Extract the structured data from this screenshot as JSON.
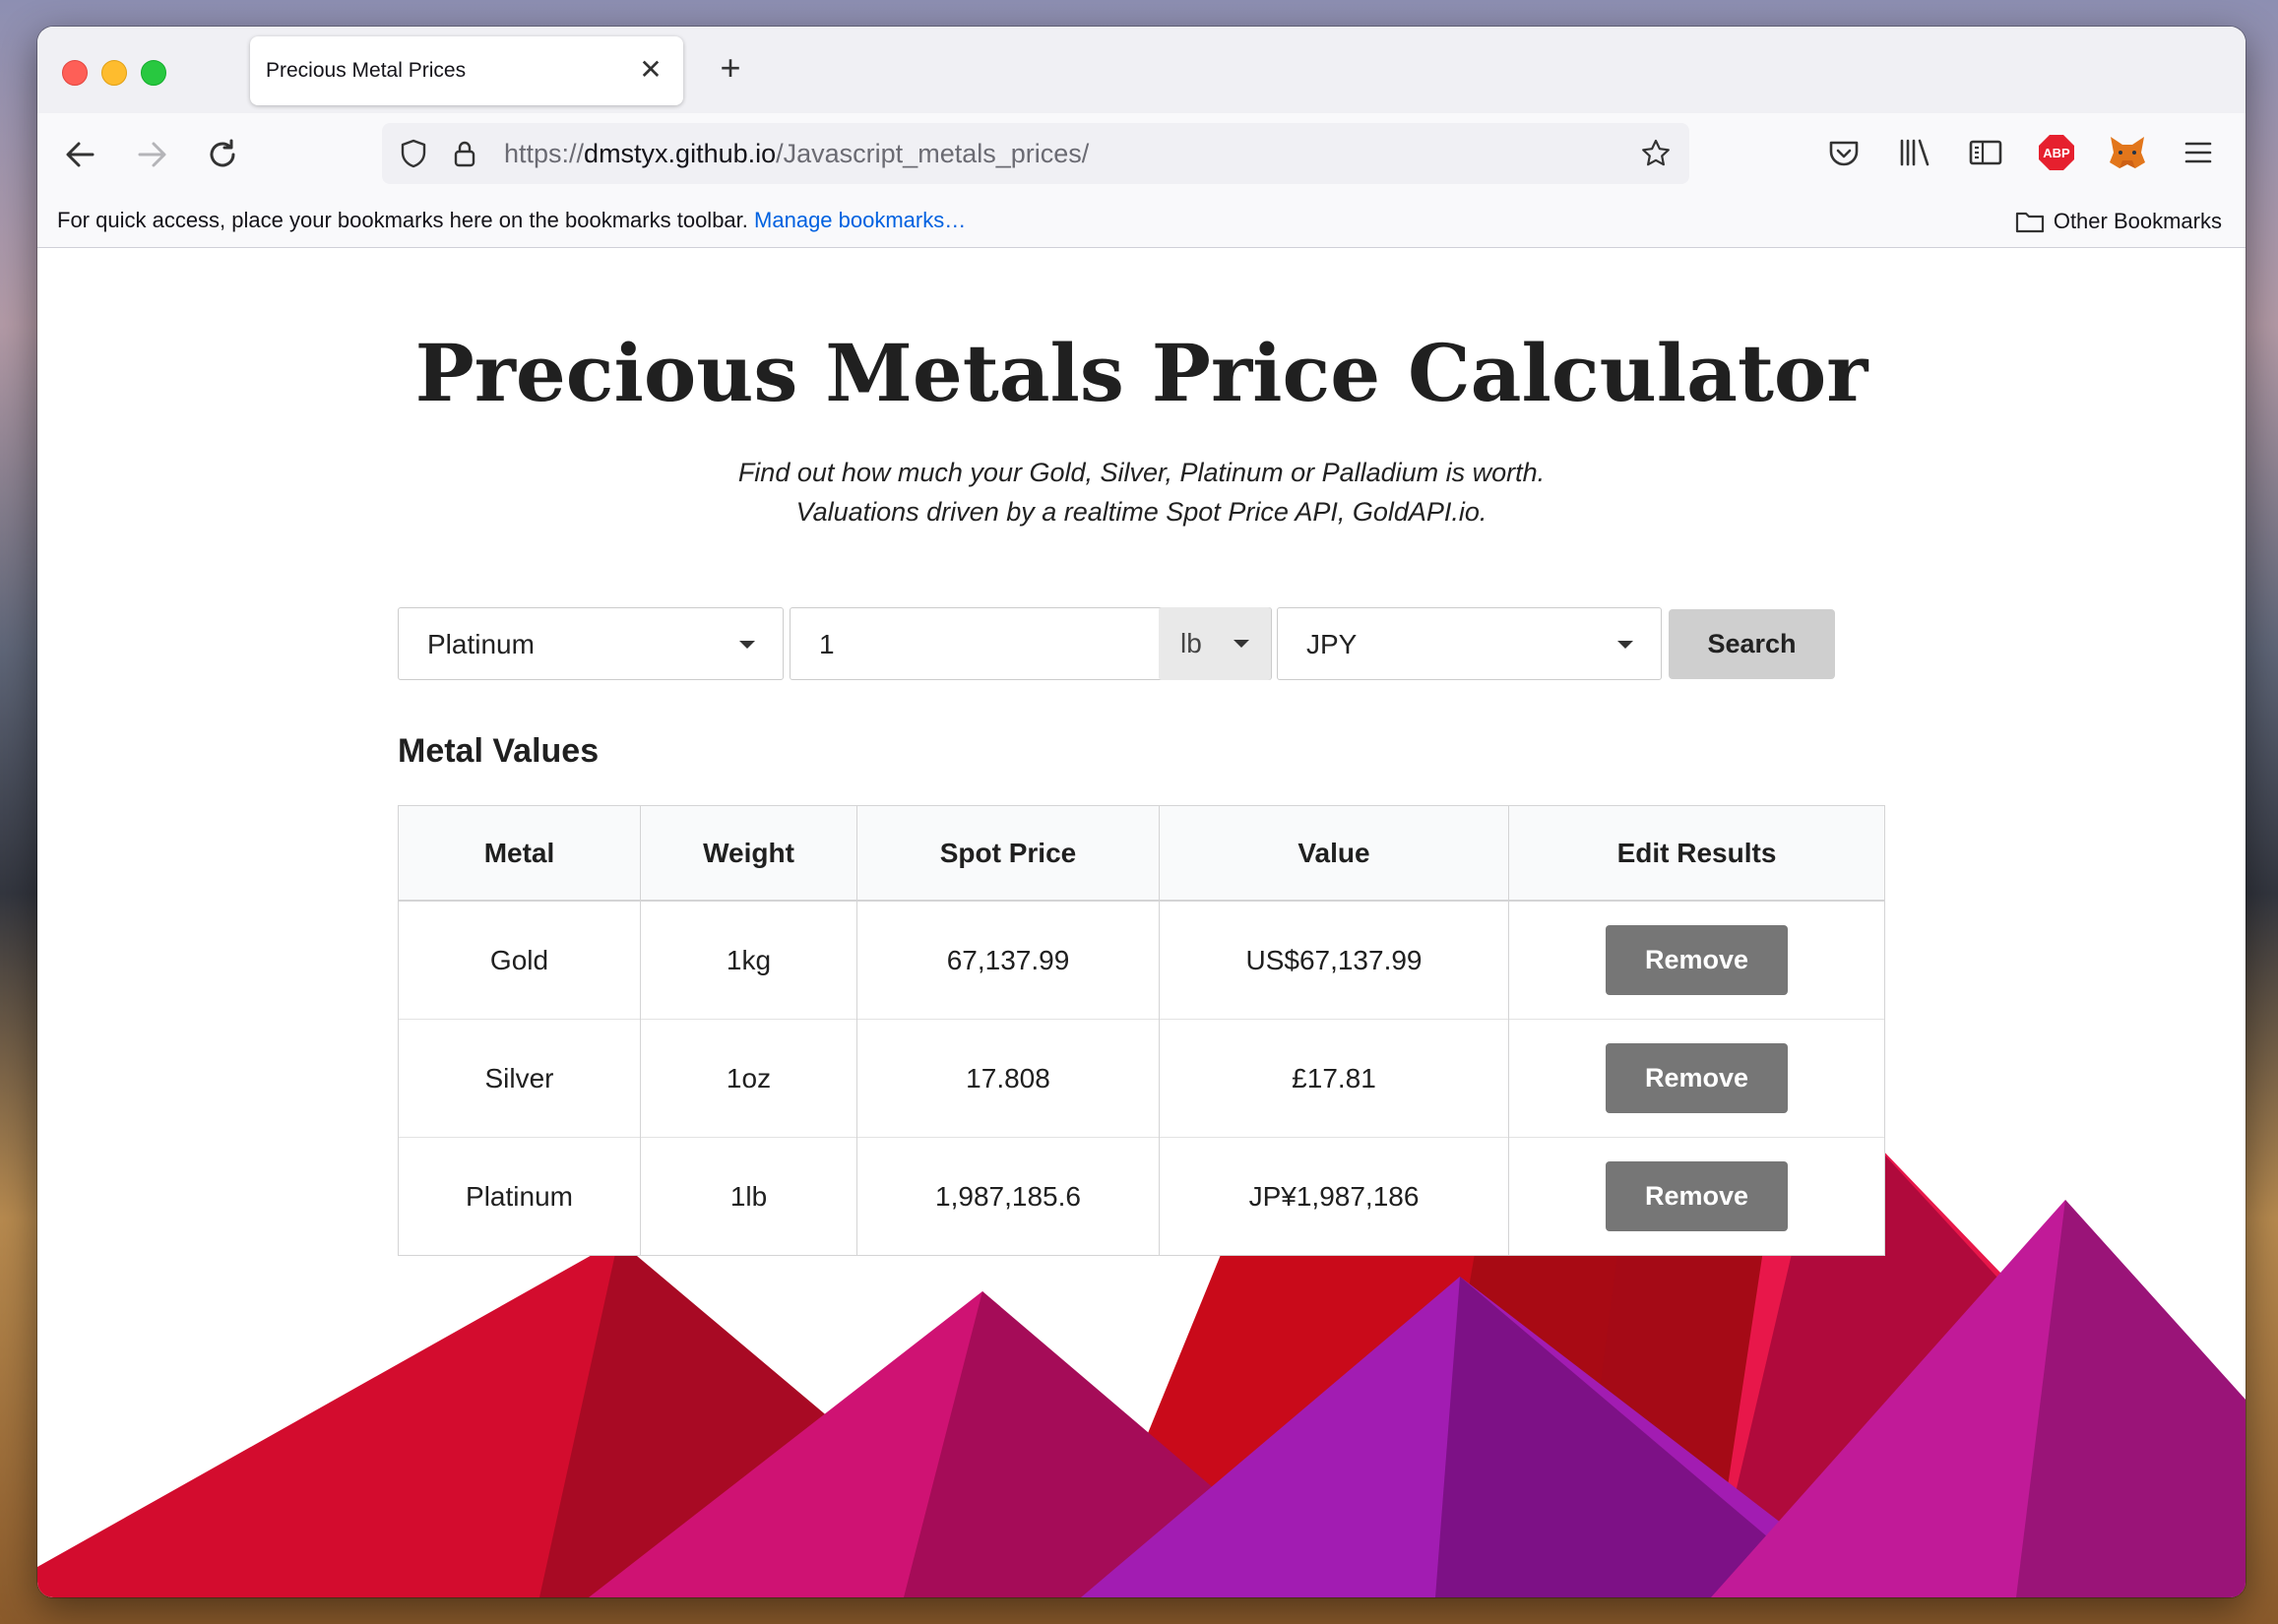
{
  "browser": {
    "tab_title": "Precious Metal Prices",
    "tab_close_glyph": "✕",
    "new_tab_glyph": "+",
    "url_scheme": "https://",
    "url_host": "dmstyx.github.io",
    "url_path": "/Javascript_metals_prices/",
    "bookmarks_hint": "For quick access, place your bookmarks here on the bookmarks toolbar.",
    "manage_bookmarks": "Manage bookmarks…",
    "other_bookmarks": "Other Bookmarks",
    "adblock_label": "ABP",
    "icons": [
      "back-icon",
      "forward-icon",
      "reload-icon",
      "shield-icon",
      "lock-icon",
      "star-icon",
      "pocket-icon",
      "library-icon",
      "sidebar-icon",
      "adblock-icon",
      "metamask-icon",
      "menu-icon",
      "folder-icon"
    ]
  },
  "page": {
    "title": "Precious Metals Price Calculator",
    "subtitle_line1": "Find out how much your Gold, Silver, Platinum or Palladium is worth.",
    "subtitle_line2": "Valuations driven by a realtime Spot Price API, GoldAPI.io."
  },
  "form": {
    "metal_selected": "Platinum",
    "quantity_value": "1",
    "unit_selected": "lb",
    "currency_selected": "JPY",
    "search_label": "Search"
  },
  "results": {
    "heading": "Metal Values",
    "columns": [
      "Metal",
      "Weight",
      "Spot Price",
      "Value",
      "Edit Results"
    ],
    "rows": [
      {
        "metal": "Gold",
        "weight": "1kg",
        "spot": "67,137.99",
        "value": "US$67,137.99",
        "action": "Remove"
      },
      {
        "metal": "Silver",
        "weight": "1oz",
        "spot": "17.808",
        "value": "£17.81",
        "action": "Remove"
      },
      {
        "metal": "Platinum",
        "weight": "1lb",
        "spot": "1,987,185.6",
        "value": "JP¥1,987,186",
        "action": "Remove"
      }
    ]
  },
  "colors": {
    "mountain_reds": [
      "#d30c2e",
      "#a80a24",
      "#c90a1a",
      "#e8174a",
      "#b00a3c"
    ],
    "mountain_magentas": [
      "#cf1273",
      "#a50c58",
      "#a21cb2",
      "#7d1186",
      "#c11a98",
      "#9a1478"
    ],
    "remove_button": "#767676",
    "search_button": "#cfcfcf"
  }
}
